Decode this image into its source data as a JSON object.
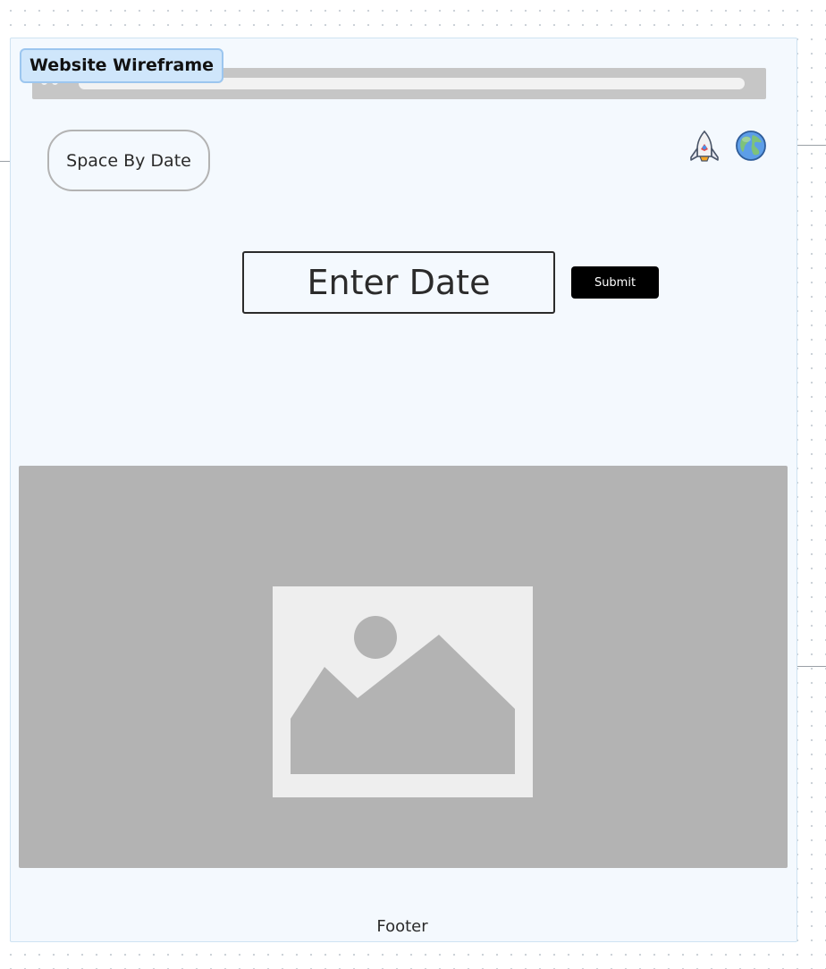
{
  "frame": {
    "label": "Website Wireframe"
  },
  "header": {
    "logo_text": "Space By Date",
    "icons": [
      "rocket-icon",
      "globe-icon"
    ]
  },
  "form": {
    "input_placeholder": "Enter Date",
    "submit_label": "Submit"
  },
  "main": {
    "image_icon": "image-placeholder-icon"
  },
  "footer": {
    "text": "Footer"
  },
  "colors": {
    "frame_background": "#f4f9fe",
    "frame_label_background": "#cfe6fb",
    "placeholder_gray": "#b3b3b3",
    "button_background": "#000000"
  }
}
